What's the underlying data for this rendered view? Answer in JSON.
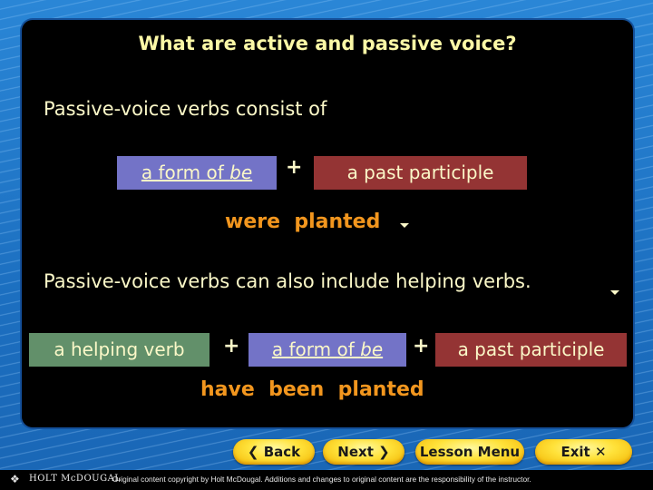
{
  "slide": {
    "title": "What are active and passive voice?",
    "line1": "Passive-voice verbs consist of",
    "row1": {
      "box_be_prefix": "a form of ",
      "box_be_italic": "be",
      "plus": "+",
      "box_participle": "a past participle",
      "example": "were  planted"
    },
    "line2": "Passive-voice verbs can also include helping verbs.",
    "row2": {
      "box_helping": "a helping verb",
      "plus1": "+",
      "box_be_prefix": "a form of ",
      "box_be_italic": "be",
      "plus2": "+",
      "box_participle": "a past participle",
      "example": "have  been  planted"
    }
  },
  "colors": {
    "title": "#fbf8a6",
    "text": "#fbf8c8",
    "example": "#f2961e",
    "be_box": "#7373c7",
    "participle_box": "#943434",
    "helping_box": "#62906a"
  },
  "nav": {
    "back": "Back",
    "next": "Next",
    "lesson_menu": "Lesson Menu",
    "exit": "Exit"
  },
  "footer": {
    "brand": "HOLT McDOUGAL",
    "copyright": "Original content copyright by Holt McDougal.  Additions and changes to original content are the responsibility of the instructor."
  }
}
